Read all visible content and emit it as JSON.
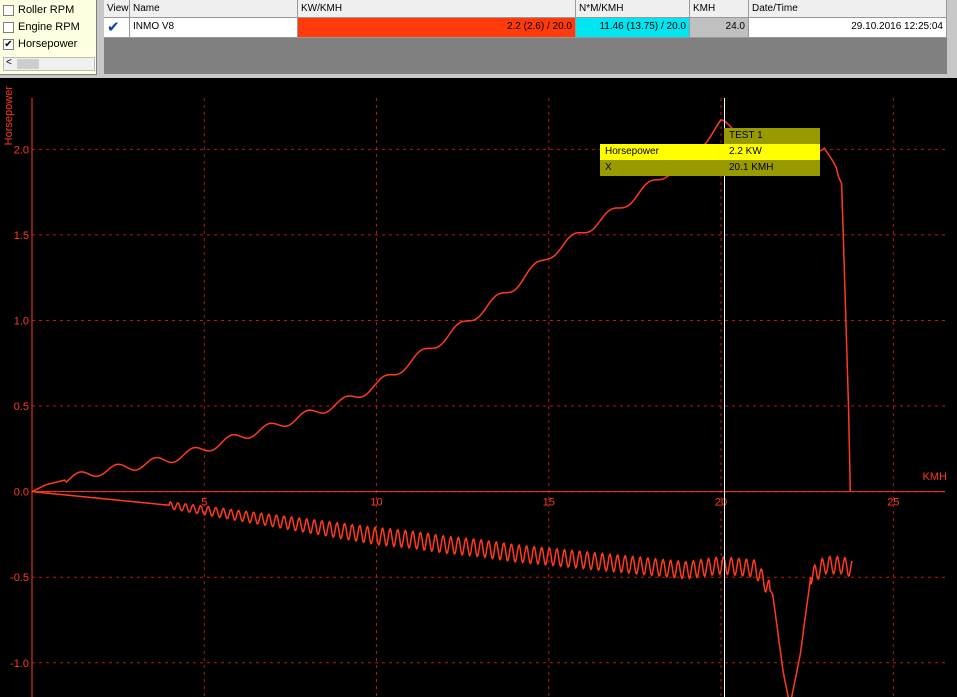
{
  "channels": [
    {
      "label": "Roller RPM",
      "checked": false
    },
    {
      "label": "Engine RPM",
      "checked": false
    },
    {
      "label": "Horsepower",
      "checked": true
    }
  ],
  "table": {
    "headers": [
      "View",
      "Name",
      "KW/KMH",
      "N*M/KMH",
      "KMH",
      "Date/Time"
    ],
    "row": {
      "name": "INMO V8",
      "kw": "2.2 (2.6) / 20.0",
      "nm": "11.46 (13.75) / 20.0",
      "kmh": "24.0",
      "datetime": "29.10.2016 12:25:04",
      "viewed": true
    }
  },
  "chart_data": {
    "type": "line",
    "ylabel": "Horsepower",
    "xlabel": "KMH",
    "xlim": [
      0,
      26.5
    ],
    "ylim": [
      -1.2,
      2.3
    ],
    "xticks": [
      5,
      10,
      15,
      20,
      25
    ],
    "yticks": [
      "-1.0",
      "-0.5",
      "0.0",
      "0.5",
      "1.0",
      "1.5",
      "2.0"
    ],
    "yticks_num": [
      -1,
      -0.5,
      0,
      0.5,
      1,
      1.5,
      2
    ],
    "grid": true,
    "colors": {
      "line": "#ff3a1e",
      "axis": "#ff3a1e",
      "grid": "#b51b0e",
      "cursor": "#ffffff"
    },
    "series": [
      {
        "x": [
          0,
          0.4,
          1,
          2,
          3,
          4,
          5,
          6,
          7,
          8,
          9,
          10,
          11,
          12,
          13,
          14,
          15,
          16,
          17,
          18,
          19,
          20,
          20.5,
          21,
          21.5,
          22,
          22.5,
          23,
          23.5,
          23.7,
          23.8
        ],
        "values": [
          0,
          0.04,
          0.07,
          0.12,
          0.15,
          0.19,
          0.25,
          0.32,
          0.38,
          0.45,
          0.52,
          0.62,
          0.76,
          0.9,
          1.05,
          1.2,
          1.38,
          1.52,
          1.65,
          1.8,
          1.95,
          2.15,
          2.1,
          2.05,
          2.0,
          1.98,
          2.0,
          2.02,
          1.8,
          0.5,
          -0.5
        ]
      },
      {
        "x": [
          0,
          1,
          2,
          3,
          4,
          5,
          6,
          7,
          8,
          9,
          10,
          11,
          12,
          13,
          14,
          15,
          16,
          17,
          18,
          19,
          20,
          21,
          21.5,
          21.8,
          22,
          22.3,
          22.6,
          23,
          23.5,
          23.8
        ],
        "values": [
          0,
          -0.02,
          -0.04,
          -0.06,
          -0.08,
          -0.11,
          -0.14,
          -0.17,
          -0.2,
          -0.23,
          -0.26,
          -0.28,
          -0.31,
          -0.33,
          -0.36,
          -0.38,
          -0.4,
          -0.42,
          -0.44,
          -0.46,
          -0.43,
          -0.45,
          -0.6,
          -1.05,
          -1.25,
          -0.95,
          -0.5,
          -0.43,
          -0.43,
          -0.45
        ]
      }
    ]
  },
  "cursor": {
    "x": 20.1,
    "header": "TEST  1",
    "rows": [
      {
        "label": "Horsepower",
        "value": "2.2 KW"
      },
      {
        "label": "X",
        "value": "20.1 KMH"
      }
    ]
  }
}
